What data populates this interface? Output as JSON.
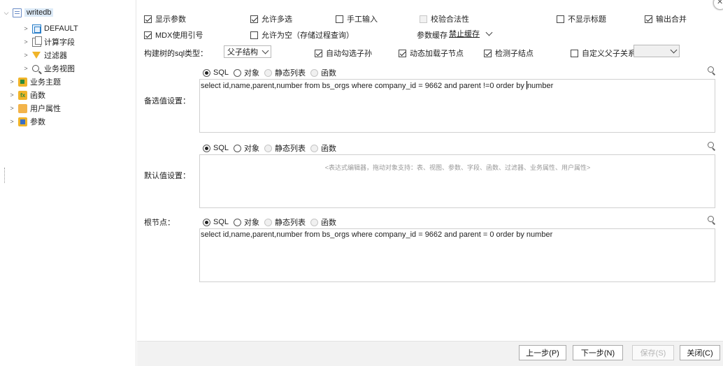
{
  "tree": {
    "root": "writedb",
    "children": [
      "DEFAULT",
      "计算字段",
      "过滤器",
      "业务视图"
    ],
    "top": [
      "业务主题",
      "函数",
      "用户属性",
      "参数"
    ]
  },
  "options": {
    "show_param": "显示参数",
    "allow_multi": "允许多选",
    "manual_input": "手工输入",
    "validate": "校验合法性",
    "hide_title": "不显示标题",
    "output_merge": "输出合并",
    "mdx_quote": "MDX使用引号",
    "allow_empty": "允许为空（存储过程查询）",
    "param_cache_label": "参数缓存",
    "param_cache_value": "禁止缓存",
    "tree_sql_label": "构建树的sql类型：",
    "tree_sql_value": "父子结构",
    "auto_check_children": "自动勾选子孙",
    "dynamic_load": "动态加载子节点",
    "detect_children": "检测子结点",
    "custom_parent_child": "自定义父子关系"
  },
  "source_types": {
    "sql": "SQL",
    "object": "对象",
    "static_list": "静态列表",
    "function": "函数"
  },
  "sections": {
    "candidate": {
      "label": "备选值设置：",
      "sql_before": "select id,name,parent,number from bs_orgs where company_id = 9662 and parent !=0 order by ",
      "sql_after": "number"
    },
    "default": {
      "label": "默认值设置：",
      "placeholder": "<表达式编辑器，拖动对象支持：表、视图、参数、字段、函数、过滤器、业务属性、用户属性>"
    },
    "root_node": {
      "label": "根节点：",
      "sql": "select id,name,parent,number from bs_orgs where company_id = 9662 and parent = 0 order by number"
    }
  },
  "footer": {
    "prev": "上一步(P)",
    "next": "下一步(N)",
    "save": "保存(S)",
    "close": "关闭(C)"
  }
}
